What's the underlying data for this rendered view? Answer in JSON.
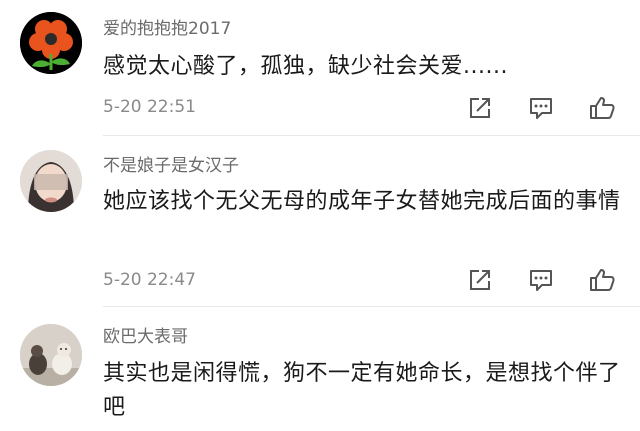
{
  "comments": [
    {
      "username": "爱的抱抱抱2017",
      "text": "感觉太心酸了，孤独，缺少社会关爱......",
      "time": "5-20 22:51"
    },
    {
      "username": "不是娘子是女汉子",
      "text": "她应该找个无父无母的成年子女替她完成后面的事情",
      "time": "5-20 22:47"
    },
    {
      "username": "欧巴大表哥",
      "text": "其实也是闲得慌，狗不一定有她命长，是想找个伴了吧"
    }
  ],
  "colors": {
    "icon": "#555555",
    "flower_petal": "#e8531e",
    "flower_center": "#2b2b2b",
    "flower_stem": "#4caf34"
  },
  "icons": [
    "share-icon",
    "reply-icon",
    "like-icon"
  ]
}
